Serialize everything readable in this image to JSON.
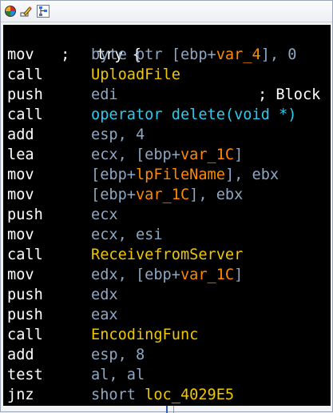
{
  "toolbar": {
    "icons": [
      "color-palette-icon",
      "edit-node-icon",
      "graph-overview-icon"
    ]
  },
  "colors": {
    "background": "#000000",
    "mnemonic": "#ffffff",
    "operand": "#8ea7c3",
    "function_name": "#f0c800",
    "variable": "#ff8a00",
    "import": "#30c8ef"
  },
  "code": {
    "try_comment": ";   try {",
    "lines": [
      {
        "mnemonic": "mov",
        "op_a": "byte ptr [ebp+",
        "op_var": "var_4",
        "op_b": "], 0"
      },
      {
        "mnemonic": "call",
        "op_func": "UploadFile"
      },
      {
        "mnemonic": "push",
        "op_a": "edi",
        "comment": "; Block"
      },
      {
        "mnemonic": "call",
        "op_import": "operator delete(void *)"
      },
      {
        "mnemonic": "add",
        "op_a": "esp, 4"
      },
      {
        "mnemonic": "lea",
        "op_a": "ecx, [ebp+",
        "op_var": "var_1C",
        "op_b": "]"
      },
      {
        "mnemonic": "mov",
        "op_a": "[ebp+",
        "op_var": "lpFileName",
        "op_b": "], ebx"
      },
      {
        "mnemonic": "mov",
        "op_a": "[ebp+",
        "op_var": "var_1C",
        "op_b": "], ebx"
      },
      {
        "mnemonic": "push",
        "op_a": "ecx"
      },
      {
        "mnemonic": "mov",
        "op_a": "ecx, esi"
      },
      {
        "mnemonic": "call",
        "op_func": "ReceivefromServer"
      },
      {
        "mnemonic": "mov",
        "op_a": "edx, [ebp+",
        "op_var": "var_1C",
        "op_b": "]"
      },
      {
        "mnemonic": "push",
        "op_a": "edx"
      },
      {
        "mnemonic": "push",
        "op_a": "eax"
      },
      {
        "mnemonic": "call",
        "op_func": "EncodingFunc"
      },
      {
        "mnemonic": "add",
        "op_a": "esp, 8"
      },
      {
        "mnemonic": "test",
        "op_a": "al, al"
      },
      {
        "mnemonic": "jnz",
        "op_a": "short ",
        "op_func": "loc_4029E5"
      }
    ]
  }
}
